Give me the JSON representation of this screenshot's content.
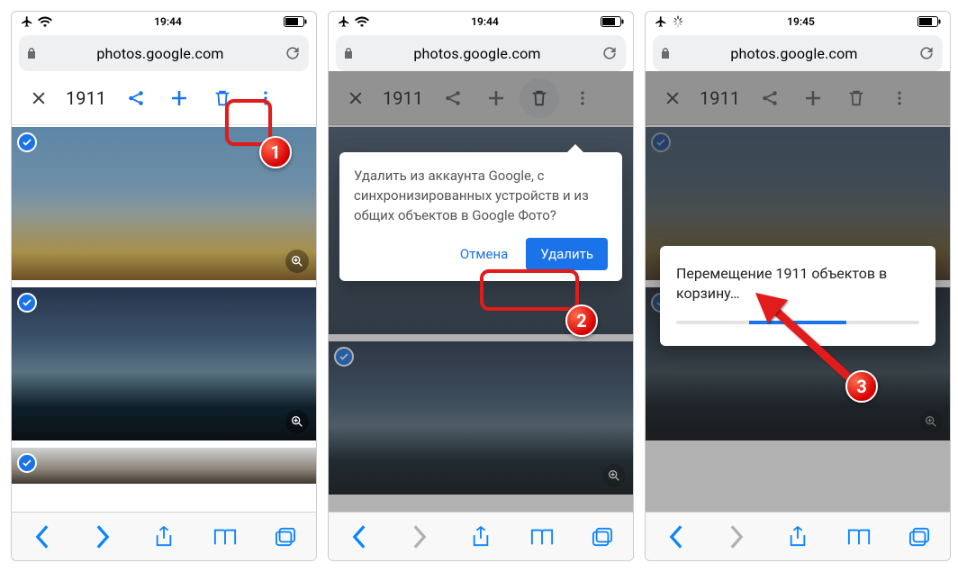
{
  "screen1": {
    "status": {
      "time": "19:44"
    },
    "url": "photos.google.com",
    "selection_count": "1911"
  },
  "screen2": {
    "status": {
      "time": "19:44"
    },
    "url": "photos.google.com",
    "selection_count": "1911",
    "dialog": {
      "message": "Удалить из аккаунта Google, с синхронизированных устройств и из общих объектов в Google Фото?",
      "cancel": "Отмена",
      "confirm": "Удалить"
    }
  },
  "screen3": {
    "status": {
      "time": "19:45"
    },
    "url": "photos.google.com",
    "selection_count": "1911",
    "toast": {
      "message": "Перемещение 1911 объектов в корзину…"
    }
  },
  "annotations": {
    "step1": "1",
    "step2": "2",
    "step3": "3"
  }
}
